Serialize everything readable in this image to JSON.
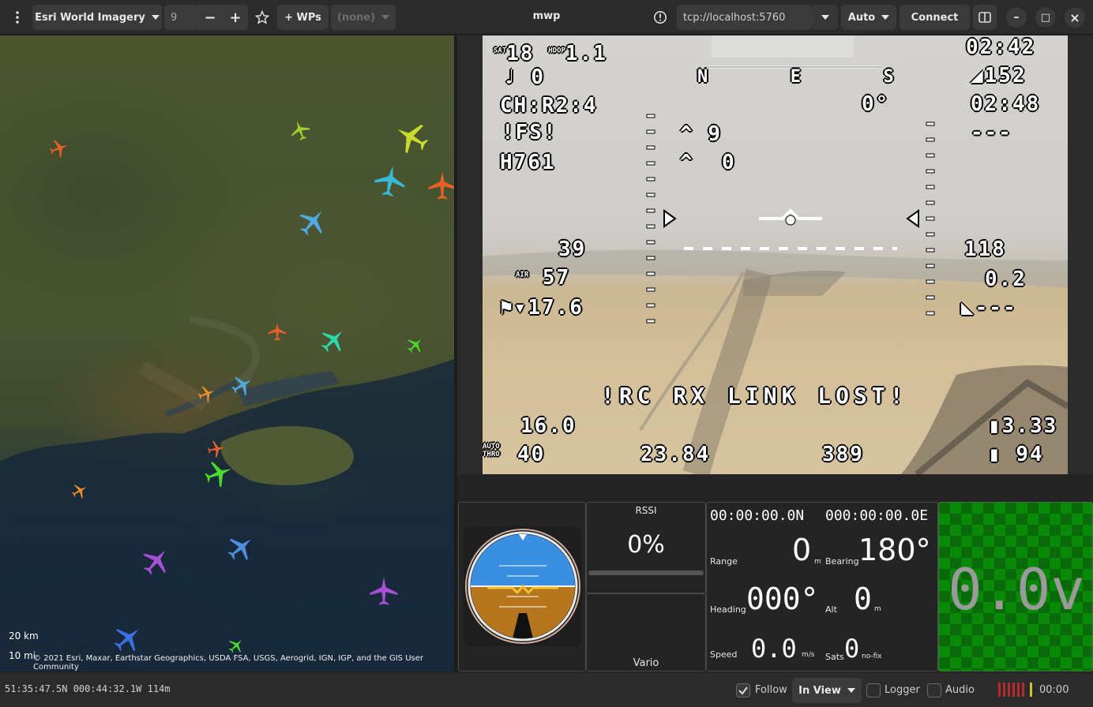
{
  "header": {
    "menu_icon": "vertical-dots-icon",
    "map_source": "Esri World Imagery",
    "zoom_value": "9",
    "zoom_out": "−",
    "zoom_in": "+",
    "favourite_icon": "star-icon",
    "wps_label": "+ WPs",
    "mission_select": "(none)",
    "title": "mwp",
    "info_icon": "info-icon",
    "device": "tcp://localhost:5760",
    "protocol": "Auto",
    "connect_label": "Connect",
    "sidebar_icon": "pane-toggle-icon",
    "minimize": "–",
    "maximize": "□",
    "close": "×"
  },
  "map": {
    "scale_km": "20 km",
    "scale_mi": "10 mi",
    "attribution": "© 2021 Esri, Maxar, Earthstar Geographics, USDA FSA, USGS, Aerogrid, IGN, IGP, and the GIS User Community"
  },
  "osd": {
    "sat": "18",
    "sat_lbl": "SAT",
    "hdop_lbl": "HDOP",
    "hdop": "1.1",
    "count": "0",
    "heading_tape": "N  E  S",
    "channel": "CH:R2:4",
    "failsafe": "!FS!",
    "h761": "H761",
    "nine": "9",
    "zero_a": "0",
    "zero_b": "0",
    "deg": "0°",
    "time1": "02:42",
    "dist1": "152",
    "time2": "02:48",
    "dash1": "---",
    "speed": "39",
    "air_lbl": "AIR",
    "air": "57",
    "wind": "17.6",
    "alt": "118",
    "vario": "0.2",
    "dash2": "---",
    "link_lost": "!RC RX LINK LOST!",
    "curr": "16.0",
    "auto_thro": "AUTO THRO",
    "thr": "40",
    "mah": "23.84",
    "eff": "389",
    "cell": "3.33",
    "pct": "94"
  },
  "rssi": {
    "label": "RSSI",
    "value": "0%",
    "level": 0
  },
  "vario": {
    "label": "Vario"
  },
  "nav": {
    "lat": "00:00:00.0N",
    "lon": "000:00:00.0E",
    "range_lbl": "Range",
    "range": "0",
    "range_unit": "m",
    "bearing_lbl": "Bearing",
    "bearing": "180°",
    "heading_lbl": "Heading",
    "heading": "000°",
    "alt_lbl": "Alt",
    "alt": "0",
    "alt_unit": "m",
    "speed_lbl": "Speed",
    "speed": "0.0",
    "speed_unit": "m/s",
    "sats_lbl": "Sats",
    "sats": "0",
    "sats_unit": "no-fix"
  },
  "volt": {
    "value": "0.0v"
  },
  "status": {
    "position": "51:35:47.5N 000:44:32.1W 114m",
    "follow": "Follow",
    "view": "In View",
    "logger": "Logger",
    "audio": "Audio",
    "elapsed": "00:00"
  },
  "colors": {
    "volt_green": "#0a7a0a",
    "bar_red": "#b52a2a",
    "bar_yellow": "#c8c82a"
  }
}
